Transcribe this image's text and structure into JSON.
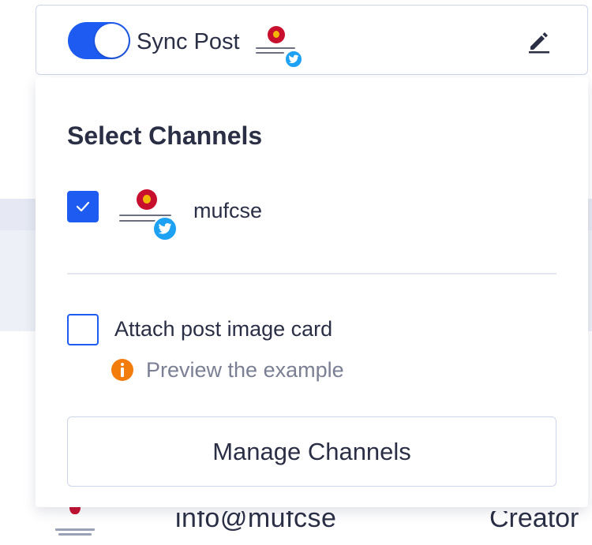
{
  "sync": {
    "label": "Sync Post",
    "enabled": true,
    "toggle_color": "#1e5bf0",
    "channel_avatar": "club-crest-avatar",
    "network_badge": "twitter-icon",
    "edit_icon": "pencil-icon"
  },
  "panel": {
    "title": "Select Channels",
    "channels": [
      {
        "name": "mufcse",
        "selected": true,
        "network": "twitter-icon"
      }
    ],
    "attach_card": {
      "label": "Attach post image card",
      "checked": false
    },
    "preview": {
      "icon": "info-icon",
      "text": "Preview the example",
      "icon_color": "#f27d0c"
    },
    "manage_button": "Manage Channels"
  },
  "background": {
    "email": "info@mufcse",
    "role": "Creator"
  },
  "colors": {
    "accent": "#1e5bf0",
    "twitter": "#1da1f2",
    "text": "#2b2f45",
    "muted": "#7a7f93",
    "border": "#cfd5ea"
  }
}
